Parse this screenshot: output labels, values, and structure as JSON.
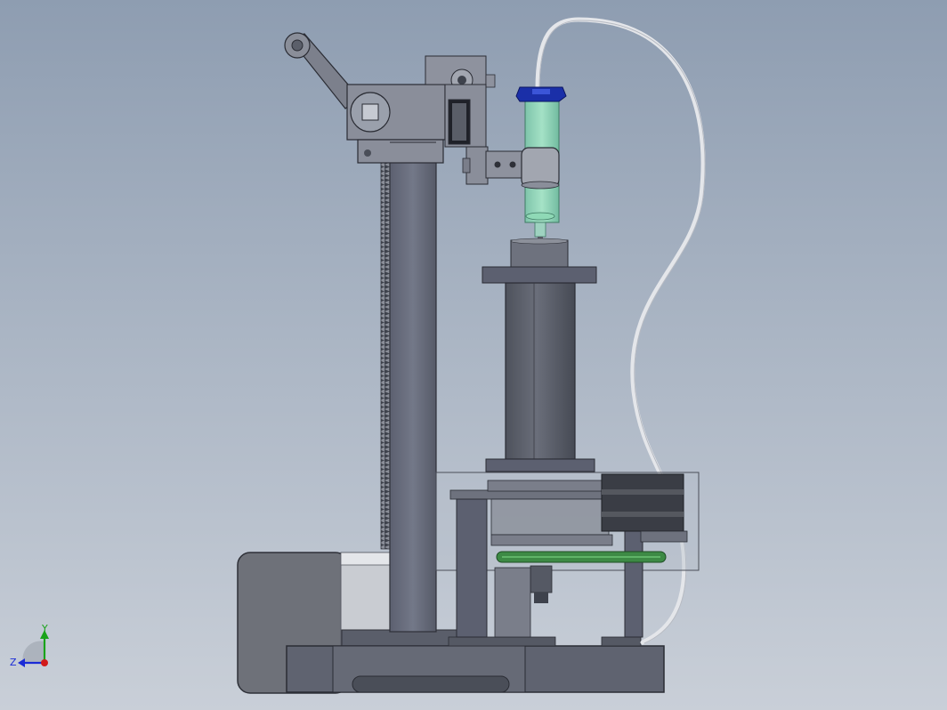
{
  "triad": {
    "y_label": "Y",
    "z_label": "Z",
    "colors": {
      "y_axis": "#1aa31a",
      "z_axis": "#1b2bd6",
      "origin": "#d11a1a"
    }
  },
  "colors": {
    "background_top": "#8e9db1",
    "background_bottom": "#c9cfd8",
    "frame_metal": "#666b78",
    "dark_metal": "#4a4e58",
    "light_metal": "#9aa0ac",
    "syringe_glass": "#7ed9b0",
    "syringe_cap": "#1a2fa8",
    "belt": "#3d8a45",
    "tube": "#e4e6ea"
  },
  "model_parts": [
    "crank-handle",
    "column-rack",
    "spindle-head",
    "syringe",
    "syringe-cap",
    "supply-tube",
    "motor-cylinder",
    "transparent-enclosure",
    "stepper-motor",
    "drive-belt",
    "base-plate",
    "side-block"
  ]
}
